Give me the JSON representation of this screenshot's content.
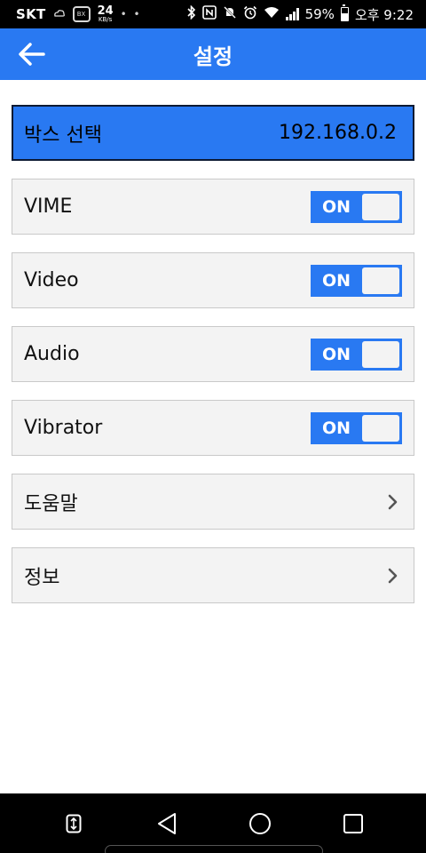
{
  "status_bar": {
    "carrier": "SKT",
    "net_speed_value": "24",
    "net_speed_unit": "KB/s",
    "box_icon_text": "BX",
    "battery_percent": "59%",
    "battery_level": 0.59,
    "time": "오후 9:22"
  },
  "app_bar": {
    "title": "설정"
  },
  "box_select": {
    "label": "박스 선택",
    "value": "192.168.0.2"
  },
  "toggles": [
    {
      "label": "VIME",
      "state": "ON"
    },
    {
      "label": "Video",
      "state": "ON"
    },
    {
      "label": "Audio",
      "state": "ON"
    },
    {
      "label": "Vibrator",
      "state": "ON"
    }
  ],
  "links": [
    {
      "label": "도움말"
    },
    {
      "label": "정보"
    }
  ],
  "colors": {
    "primary": "#2979f2",
    "row_background": "#f3f3f3",
    "row_border": "#c9c9c9"
  }
}
